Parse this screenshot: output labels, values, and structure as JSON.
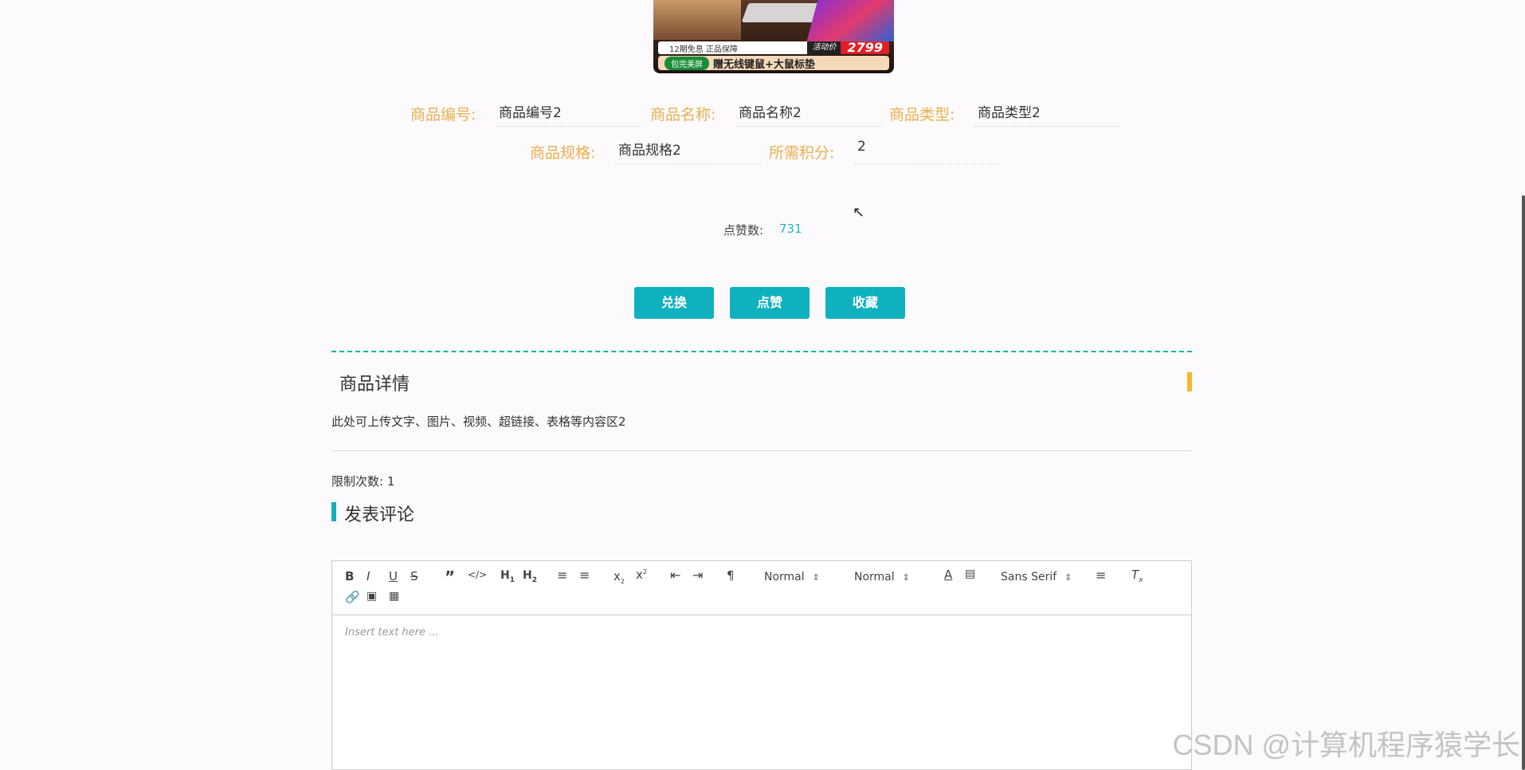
{
  "product_image": {
    "guarantee_text": "12期免息 正品保障",
    "activity_label": "活动价",
    "price": "2799",
    "badge": "包完美屏",
    "gift_text": "赠无线键鼠+大鼠标垫"
  },
  "fields": {
    "code": {
      "label": "商品编号:",
      "value": "商品编号2"
    },
    "name": {
      "label": "商品名称:",
      "value": "商品名称2"
    },
    "type": {
      "label": "商品类型:",
      "value": "商品类型2"
    },
    "spec": {
      "label": "商品规格:",
      "value": "商品规格2"
    },
    "points": {
      "label": "所需积分:",
      "value": "2"
    }
  },
  "likes": {
    "label": "点赞数:",
    "value": "731"
  },
  "buttons": {
    "exchange": "兑换",
    "like": "点赞",
    "favorite": "收藏"
  },
  "detail": {
    "title": "商品详情",
    "content": "此处可上传文字、图片、视频、超链接、表格等内容区2"
  },
  "limit": {
    "text": "限制次数: 1"
  },
  "comment": {
    "title": "发表评论"
  },
  "editor": {
    "size_select": "Normal",
    "header_select": "Normal",
    "font_select": "Sans Serif",
    "placeholder": "Insert text here ..."
  },
  "watermark": "CSDN @计算机程序猿学长"
}
